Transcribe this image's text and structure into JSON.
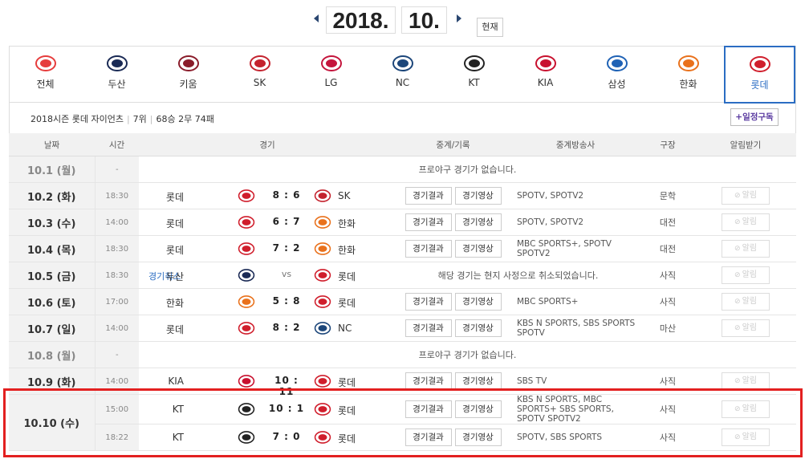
{
  "nav": {
    "year": "2018.",
    "month": "10.",
    "now_label": "현재"
  },
  "teams": [
    {
      "name": "전체",
      "color": "#e63c3c"
    },
    {
      "name": "두산",
      "color": "#1a2a55"
    },
    {
      "name": "키움",
      "color": "#8a1c2a"
    },
    {
      "name": "SK",
      "color": "#c4232e"
    },
    {
      "name": "LG",
      "color": "#c4153c"
    },
    {
      "name": "NC",
      "color": "#1c467a"
    },
    {
      "name": "KT",
      "color": "#222222"
    },
    {
      "name": "KIA",
      "color": "#c8102e"
    },
    {
      "name": "삼성",
      "color": "#1f62b5"
    },
    {
      "name": "한화",
      "color": "#e9711c"
    },
    {
      "name": "롯데",
      "color": "#d01e2c",
      "selected": true
    }
  ],
  "season": {
    "title": "2018시즌 롯데 자이언츠",
    "rank": "7위",
    "record": "68승 2무 74패",
    "subscribe_label": "+일정구독"
  },
  "columns": [
    "날짜",
    "시간",
    "경기",
    "중계/기록",
    "중계방송사",
    "구장",
    "알림받기"
  ],
  "result_label": "경기결과",
  "video_label": "경기영상",
  "alarm_label": "알림",
  "games": [
    {
      "date": "10.1 (월)",
      "off": true,
      "message": "프로야구 경기가 없습니다."
    },
    {
      "date": "10.2 (화)",
      "time": "18:30",
      "away": "롯데",
      "away_color": "#d01e2c",
      "score": "8 : 6",
      "home": "SK",
      "home_color": "#c4232e",
      "broadcast": "SPOTV, SPOTV2",
      "stadium": "문학"
    },
    {
      "date": "10.3 (수)",
      "time": "14:00",
      "away": "롯데",
      "away_color": "#d01e2c",
      "score": "6 : 7",
      "home": "한화",
      "home_color": "#e9711c",
      "broadcast": "SPOTV, SPOTV2",
      "stadium": "대전"
    },
    {
      "date": "10.4 (목)",
      "time": "18:30",
      "away": "롯데",
      "away_color": "#d01e2c",
      "score": "7 : 2",
      "home": "한화",
      "home_color": "#e9711c",
      "broadcast": "MBC SPORTS+, SPOTV SPOTV2",
      "stadium": "대전"
    },
    {
      "date": "10.5 (금)",
      "time": "18:30",
      "note": "경기취소",
      "away": "두산",
      "away_color": "#1a2a55",
      "score": "vs",
      "home": "롯데",
      "home_color": "#d01e2c",
      "cancel_message": "해당 경기는 현지 사정으로 취소되었습니다.",
      "stadium": "사직"
    },
    {
      "date": "10.6 (토)",
      "time": "17:00",
      "away": "한화",
      "away_color": "#e9711c",
      "score": "5 : 8",
      "home": "롯데",
      "home_color": "#d01e2c",
      "broadcast": "MBC SPORTS+",
      "stadium": "사직"
    },
    {
      "date": "10.7 (일)",
      "time": "14:00",
      "away": "롯데",
      "away_color": "#d01e2c",
      "score": "8 : 2",
      "home": "NC",
      "home_color": "#1c467a",
      "broadcast": "KBS N SPORTS, SBS SPORTS SPOTV",
      "stadium": "마산"
    },
    {
      "date": "10.8 (월)",
      "off": true,
      "message": "프로야구 경기가 없습니다."
    },
    {
      "date": "10.9 (화)",
      "time": "14:00",
      "away": "KIA",
      "away_color": "#c8102e",
      "score": "10 : 11",
      "home": "롯데",
      "home_color": "#d01e2c",
      "broadcast": "SBS TV",
      "stadium": "사직"
    },
    {
      "date": "10.10 (수)",
      "time": "15:00",
      "away": "KT",
      "away_color": "#222222",
      "score": "10 : 1",
      "home": "롯데",
      "home_color": "#d01e2c",
      "broadcast": "KBS N SPORTS, MBC SPORTS+ SBS SPORTS, SPOTV SPOTV2",
      "stadium": "사직",
      "rowspan": 2
    },
    {
      "date": "",
      "time": "18:22",
      "away": "KT",
      "away_color": "#222222",
      "score": "7 : 0",
      "home": "롯데",
      "home_color": "#d01e2c",
      "broadcast": "SPOTV, SBS SPORTS",
      "stadium": "사직",
      "continued": true
    }
  ]
}
